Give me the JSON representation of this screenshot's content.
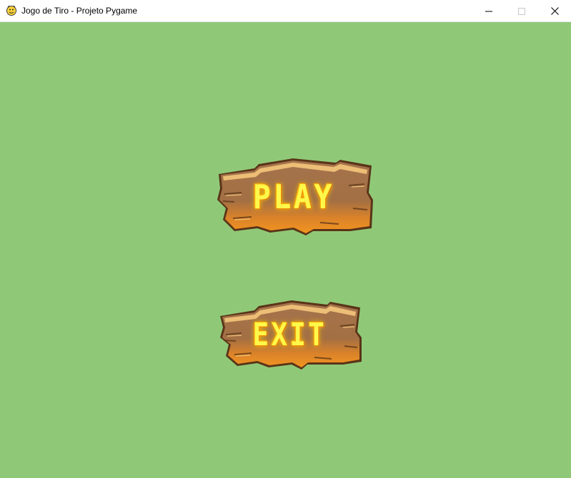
{
  "window": {
    "title": "Jogo de Tiro - Projeto Pygame",
    "app_icon": "pygame-snake-icon",
    "controls": {
      "minimize_icon": "minimize-icon",
      "maximize_icon": "maximize-icon",
      "close_icon": "close-icon"
    }
  },
  "game": {
    "background_color": "#8fc978",
    "menu": {
      "play_label": "PLAY",
      "exit_label": "EXIT"
    },
    "sign_colors": {
      "wood_top": "#a5744c",
      "wood_bottom": "#f08c1e",
      "outline": "#5a3418",
      "highlight": "#f4c77b",
      "text": "#fff84a"
    }
  }
}
